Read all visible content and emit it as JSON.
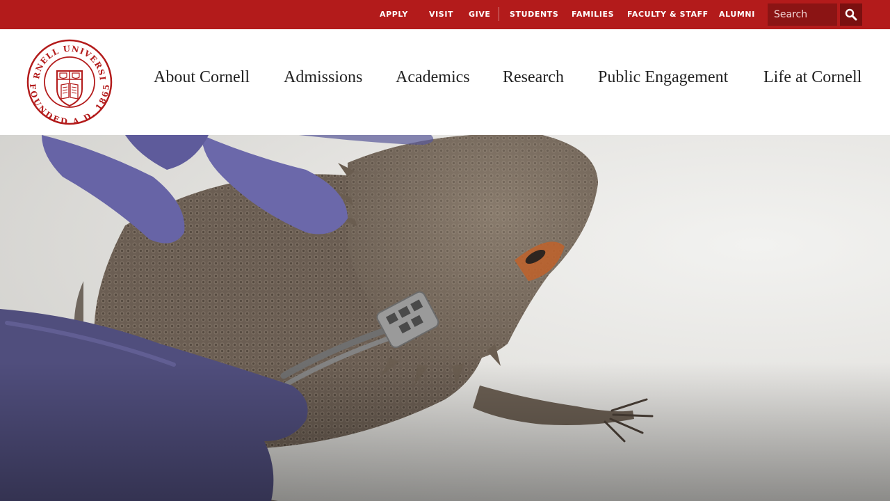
{
  "utility_nav": {
    "links": [
      {
        "label": "APPLY"
      },
      {
        "label": "VISIT"
      },
      {
        "label": "GIVE"
      },
      {
        "label": "STUDENTS"
      },
      {
        "label": "FAMILIES"
      },
      {
        "label": "FACULTY & STAFF"
      },
      {
        "label": "ALUMNI"
      }
    ],
    "search": {
      "placeholder": "Search",
      "value": ""
    },
    "search_icon": "magnifier-icon"
  },
  "logo": {
    "ring_text_top": "CORNELL UNIVERSITY",
    "ring_text_bottom": "FOUNDED A.D. 1865"
  },
  "main_nav": {
    "items": [
      {
        "label": "About Cornell"
      },
      {
        "label": "Admissions"
      },
      {
        "label": "Academics"
      },
      {
        "label": "Research"
      },
      {
        "label": "Public Engagement"
      },
      {
        "label": "Life at Cornell"
      }
    ]
  },
  "colors": {
    "brand_red": "#b31b1b",
    "search_bg": "#8b1414",
    "glove_purple": "#5f5c9c"
  }
}
